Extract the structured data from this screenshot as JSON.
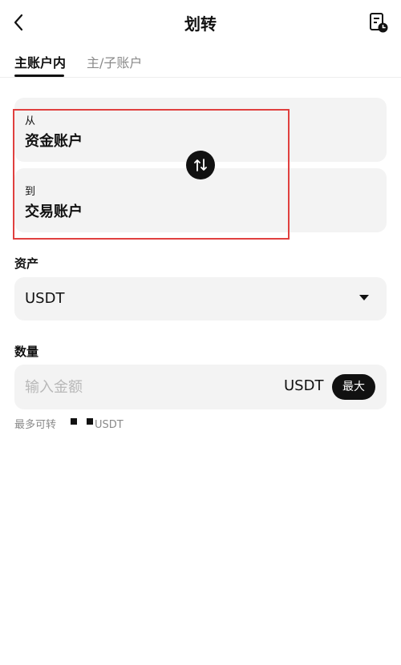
{
  "header": {
    "title": "划转",
    "back_icon": "chevron-left-icon",
    "history_icon": "document-clock-icon"
  },
  "tabs": [
    {
      "label": "主账户内",
      "active": true
    },
    {
      "label": "主/子账户",
      "active": false
    }
  ],
  "transfer": {
    "from": {
      "label": "从",
      "account": "资金账户"
    },
    "to": {
      "label": "到",
      "account": "交易账户"
    },
    "swap_icon": "swap-arrows-icon"
  },
  "asset": {
    "label": "资产",
    "value": "USDT"
  },
  "quantity": {
    "label": "数量",
    "placeholder": "输入金额",
    "unit": "USDT",
    "max_label": "最大",
    "available_prefix": "最多可转",
    "available_unit": "USDT"
  },
  "colors": {
    "highlight": "#e0403f",
    "card_bg": "#f3f3f3",
    "accent": "#111111"
  }
}
